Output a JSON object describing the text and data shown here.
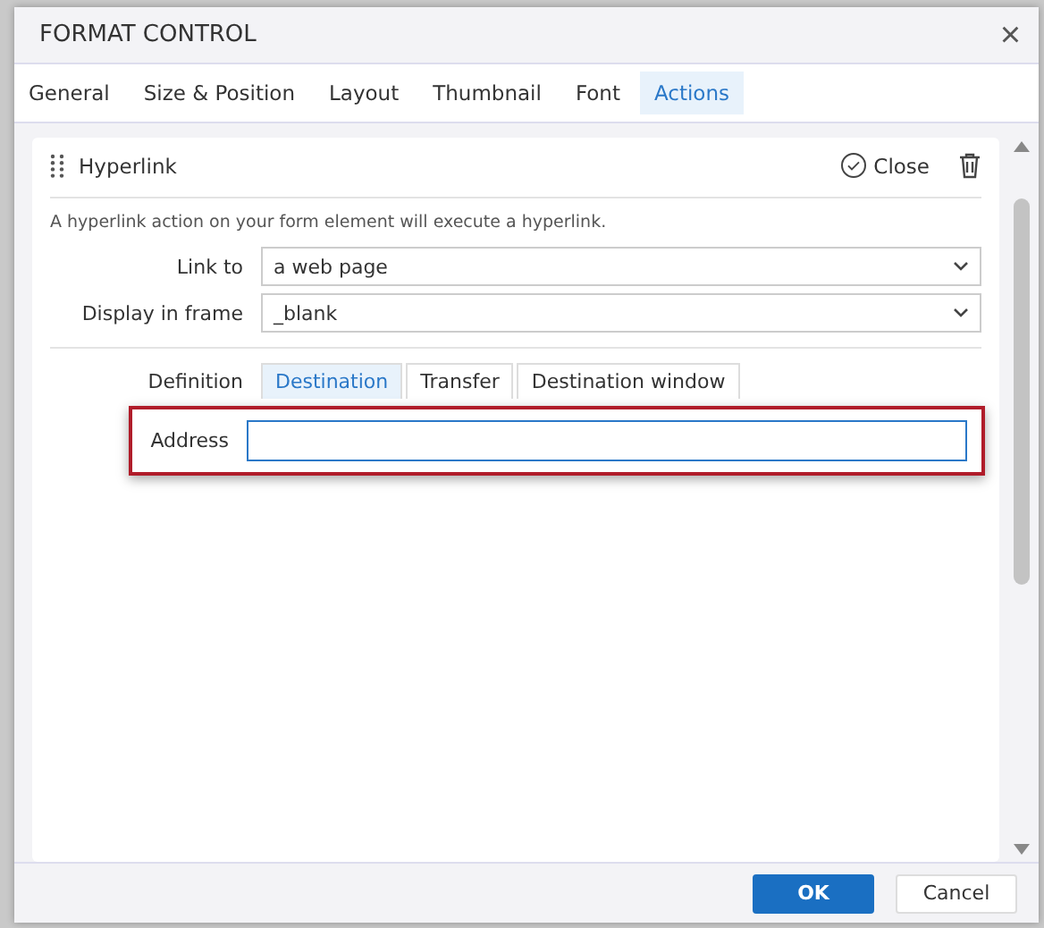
{
  "window": {
    "title": "FORMAT CONTROL",
    "close": "×"
  },
  "tabs": [
    {
      "label": "General",
      "selected": false
    },
    {
      "label": "Size & Position",
      "selected": false
    },
    {
      "label": "Layout",
      "selected": false
    },
    {
      "label": "Thumbnail",
      "selected": false
    },
    {
      "label": "Font",
      "selected": false
    },
    {
      "label": "Actions",
      "selected": true
    }
  ],
  "action": {
    "title": "Hyperlink",
    "close_label": "Close",
    "description": "A hyperlink action on your form element will execute a hyperlink.",
    "fields": [
      {
        "label": "Link to",
        "value": "a web page"
      },
      {
        "label": "Display in frame",
        "value": "_blank"
      }
    ],
    "definition_label": "Definition",
    "definition_tabs": [
      {
        "label": "Destination",
        "selected": true
      },
      {
        "label": "Transfer",
        "selected": false
      },
      {
        "label": "Destination window",
        "selected": false
      }
    ],
    "address": {
      "label": "Address",
      "highlighted": true
    }
  },
  "buttons": [
    {
      "label": "OK",
      "kind": "primary"
    },
    {
      "label": "Cancel",
      "kind": "secondary"
    }
  ]
}
